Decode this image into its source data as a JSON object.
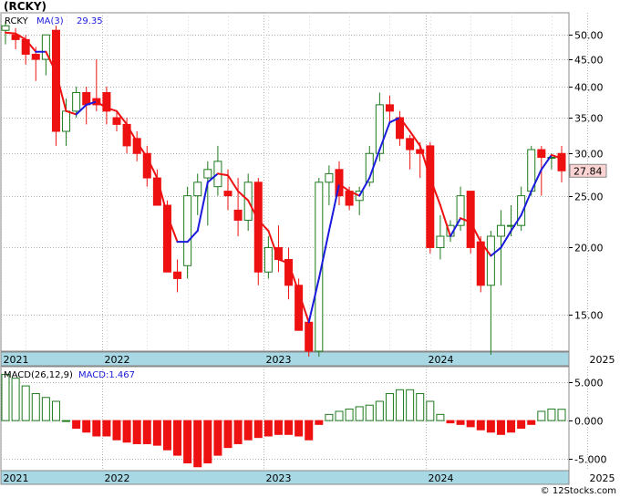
{
  "title": "(RCKY)",
  "footer": "© 12Stocks.com",
  "colors": {
    "up": "#1e7a1e",
    "down": "#ee1111",
    "ma_up": "#1a1adc",
    "ma_down": "#ee1111",
    "axis_band": "#a8d8e4",
    "grid": "#b4b4b4",
    "last_price_bg": "#fbd3d3"
  },
  "chart_data": [
    {
      "type": "candlestick",
      "legend": {
        "ticker": "RCKY",
        "ma_label": "MA(3)",
        "ma_value": "29.35"
      },
      "last_price": "27.84",
      "y_scale": "log",
      "ylim": [
        12.8,
        55
      ],
      "y_ticks": [
        {
          "label": "50.00",
          "value": 50
        },
        {
          "label": "45.00",
          "value": 45
        },
        {
          "label": "40.00",
          "value": 40
        },
        {
          "label": "35.00",
          "value": 35
        },
        {
          "label": "30.00",
          "value": 30
        },
        {
          "label": "25.00",
          "value": 25
        },
        {
          "label": "20.00",
          "value": 20
        },
        {
          "label": "15.00",
          "value": 15
        }
      ],
      "x_ticks": [
        "2021",
        "2022",
        "2023",
        "2024",
        "2025"
      ],
      "x_tick_index": [
        0,
        10,
        26,
        42,
        58
      ],
      "grid": true,
      "ohlc": [
        [
          51,
          53,
          48,
          52
        ],
        [
          50,
          51.5,
          47,
          49
        ],
        [
          49,
          50,
          44,
          46
        ],
        [
          46,
          47.5,
          41,
          45
        ],
        [
          45,
          48,
          42,
          50
        ],
        [
          51,
          52,
          31,
          33
        ],
        [
          33,
          38,
          31,
          36
        ],
        [
          36,
          40,
          35,
          39
        ],
        [
          39,
          40,
          34,
          37
        ],
        [
          38,
          45,
          36,
          37
        ],
        [
          39,
          40,
          34,
          36
        ],
        [
          35,
          36,
          33,
          34
        ],
        [
          34,
          35,
          30,
          31
        ],
        [
          32,
          33,
          29,
          30
        ],
        [
          30,
          31,
          26,
          27
        ],
        [
          27,
          28,
          24,
          24
        ],
        [
          24,
          24.5,
          18,
          18
        ],
        [
          18,
          19,
          16.5,
          17.5
        ],
        [
          18.5,
          26,
          17.5,
          25
        ],
        [
          25,
          27.5,
          23,
          26.5
        ],
        [
          27,
          29,
          22,
          28
        ],
        [
          26,
          31,
          25,
          29
        ],
        [
          25.5,
          28,
          23.5,
          25
        ],
        [
          23.5,
          27,
          21,
          22.5
        ],
        [
          22.5,
          27.5,
          21.5,
          26.5
        ],
        [
          26.5,
          27,
          17,
          18
        ],
        [
          18,
          21,
          17.5,
          20
        ],
        [
          20,
          22,
          18,
          19
        ],
        [
          19,
          20,
          16,
          17
        ],
        [
          17,
          17.5,
          15,
          14
        ],
        [
          14.5,
          14.5,
          12.5,
          12.8
        ],
        [
          12.8,
          27,
          12.5,
          26.5
        ],
        [
          26.5,
          28.5,
          24,
          27.5
        ],
        [
          28,
          29,
          24,
          25
        ],
        [
          25.5,
          26,
          23.5,
          24
        ],
        [
          24.5,
          26,
          23,
          25.5
        ],
        [
          26.5,
          31,
          26,
          30
        ],
        [
          30,
          39,
          29,
          37
        ],
        [
          37,
          38.5,
          34,
          36
        ],
        [
          35,
          36,
          31,
          32
        ],
        [
          32,
          32.5,
          28,
          30.5
        ],
        [
          30.5,
          31.5,
          27,
          30
        ],
        [
          31,
          31.5,
          19.5,
          20
        ],
        [
          20,
          23,
          19,
          21
        ],
        [
          21,
          22.5,
          20.5,
          22
        ],
        [
          22,
          26,
          21.5,
          25
        ],
        [
          25.5,
          25.5,
          19.5,
          20
        ],
        [
          20.5,
          21,
          16.5,
          17
        ],
        [
          17,
          21.5,
          12.6,
          21
        ],
        [
          21,
          23.5,
          17,
          22
        ],
        [
          22,
          24,
          21,
          22
        ],
        [
          22,
          26,
          21.5,
          25
        ],
        [
          25.5,
          31,
          25,
          30.5
        ],
        [
          30.5,
          31,
          25,
          29.5
        ],
        [
          29.5,
          30,
          28,
          29.5
        ],
        [
          30,
          31,
          26.5,
          27.84
        ]
      ],
      "ma_values": [
        50.5,
        50.3,
        49,
        46.5,
        46.5,
        42.5,
        36,
        35.5,
        37,
        37.5,
        36.5,
        36,
        34,
        31.5,
        29.5,
        27,
        23,
        20.5,
        20.5,
        21.5,
        26.5,
        27.5,
        27.3,
        25.5,
        24.5,
        22.5,
        21.5,
        19,
        18.7,
        16.5,
        14.5,
        17.5,
        21.5,
        26.3,
        25.5,
        25,
        27,
        30.5,
        34.3,
        35,
        33,
        31,
        27,
        24,
        21,
        22.7,
        22.3,
        20.5,
        19.3,
        20,
        21.5,
        23,
        25.5,
        28,
        29.8,
        29.35
      ]
    },
    {
      "type": "bar",
      "legend": {
        "label": "MACD(26,12,9)",
        "value_label": "MACD:1.467"
      },
      "ylim": [
        -6.5,
        7
      ],
      "y_ticks": [
        {
          "label": "5.000",
          "value": 5
        },
        {
          "label": "0.000",
          "value": 0
        },
        {
          "label": "-5.000",
          "value": -5
        }
      ],
      "x_ticks": [
        "2021",
        "2022",
        "2023",
        "2024",
        "2025"
      ],
      "values": [
        6,
        5.5,
        4.5,
        3.5,
        3,
        2.5,
        0,
        -1,
        -1.5,
        -2,
        -2,
        -2.5,
        -2.8,
        -3,
        -3,
        -3.2,
        -3.8,
        -4.5,
        -5.5,
        -6,
        -5.5,
        -4.5,
        -3.5,
        -3,
        -2.5,
        -2.2,
        -2,
        -1.8,
        -1.8,
        -2,
        -2.5,
        -0.5,
        0.8,
        1.2,
        1.5,
        1.8,
        2,
        2.5,
        3.5,
        4,
        4,
        3.5,
        2.5,
        0.8,
        -0.3,
        -0.5,
        -0.8,
        -1.2,
        -1.5,
        -1.8,
        -1.5,
        -1,
        -0.5,
        1.2,
        1.5,
        1.467
      ]
    }
  ]
}
